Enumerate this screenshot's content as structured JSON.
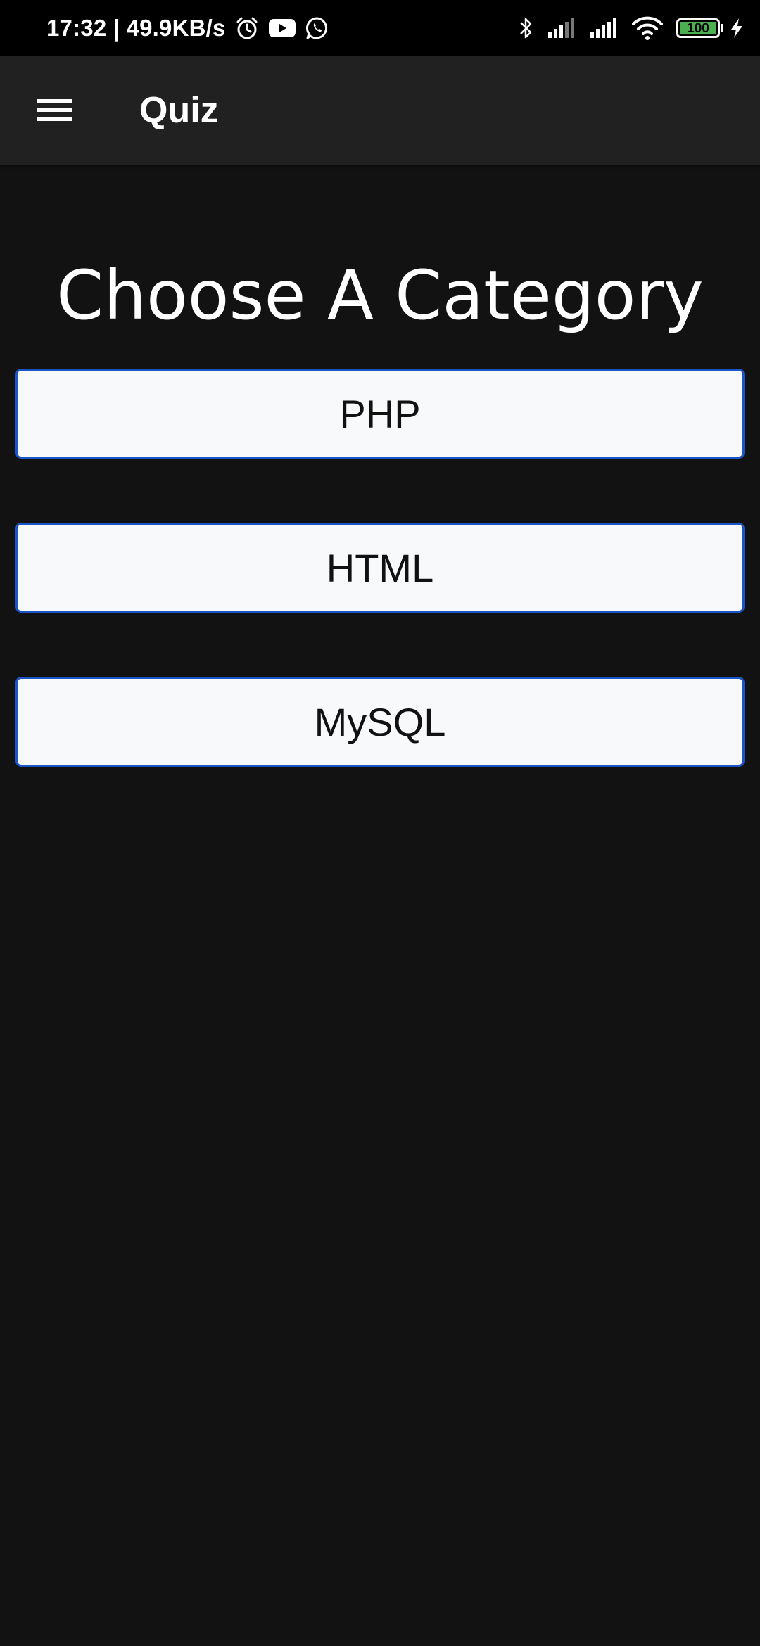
{
  "status_bar": {
    "time_and_speed": "17:32 | 49.9KB/s",
    "battery_level": "100",
    "icons_left": [
      "alarm-icon",
      "youtube-icon",
      "whatsapp-icon"
    ],
    "icons_right": [
      "bluetooth-icon",
      "signal-icon",
      "signal-icon",
      "wifi-icon",
      "battery-icon",
      "charging-icon"
    ]
  },
  "app_bar": {
    "title": "Quiz",
    "menu_icon": "hamburger-menu-icon"
  },
  "main": {
    "heading": "Choose A Category",
    "categories": [
      {
        "label": "PHP"
      },
      {
        "label": "HTML"
      },
      {
        "label": "MySQL"
      }
    ]
  },
  "colors": {
    "background": "#121212",
    "app_bar": "#212121",
    "status_bar": "#000000",
    "button_background": "#f8f9fb",
    "button_border": "#1a56c8",
    "battery_fill": "#4caf50"
  }
}
